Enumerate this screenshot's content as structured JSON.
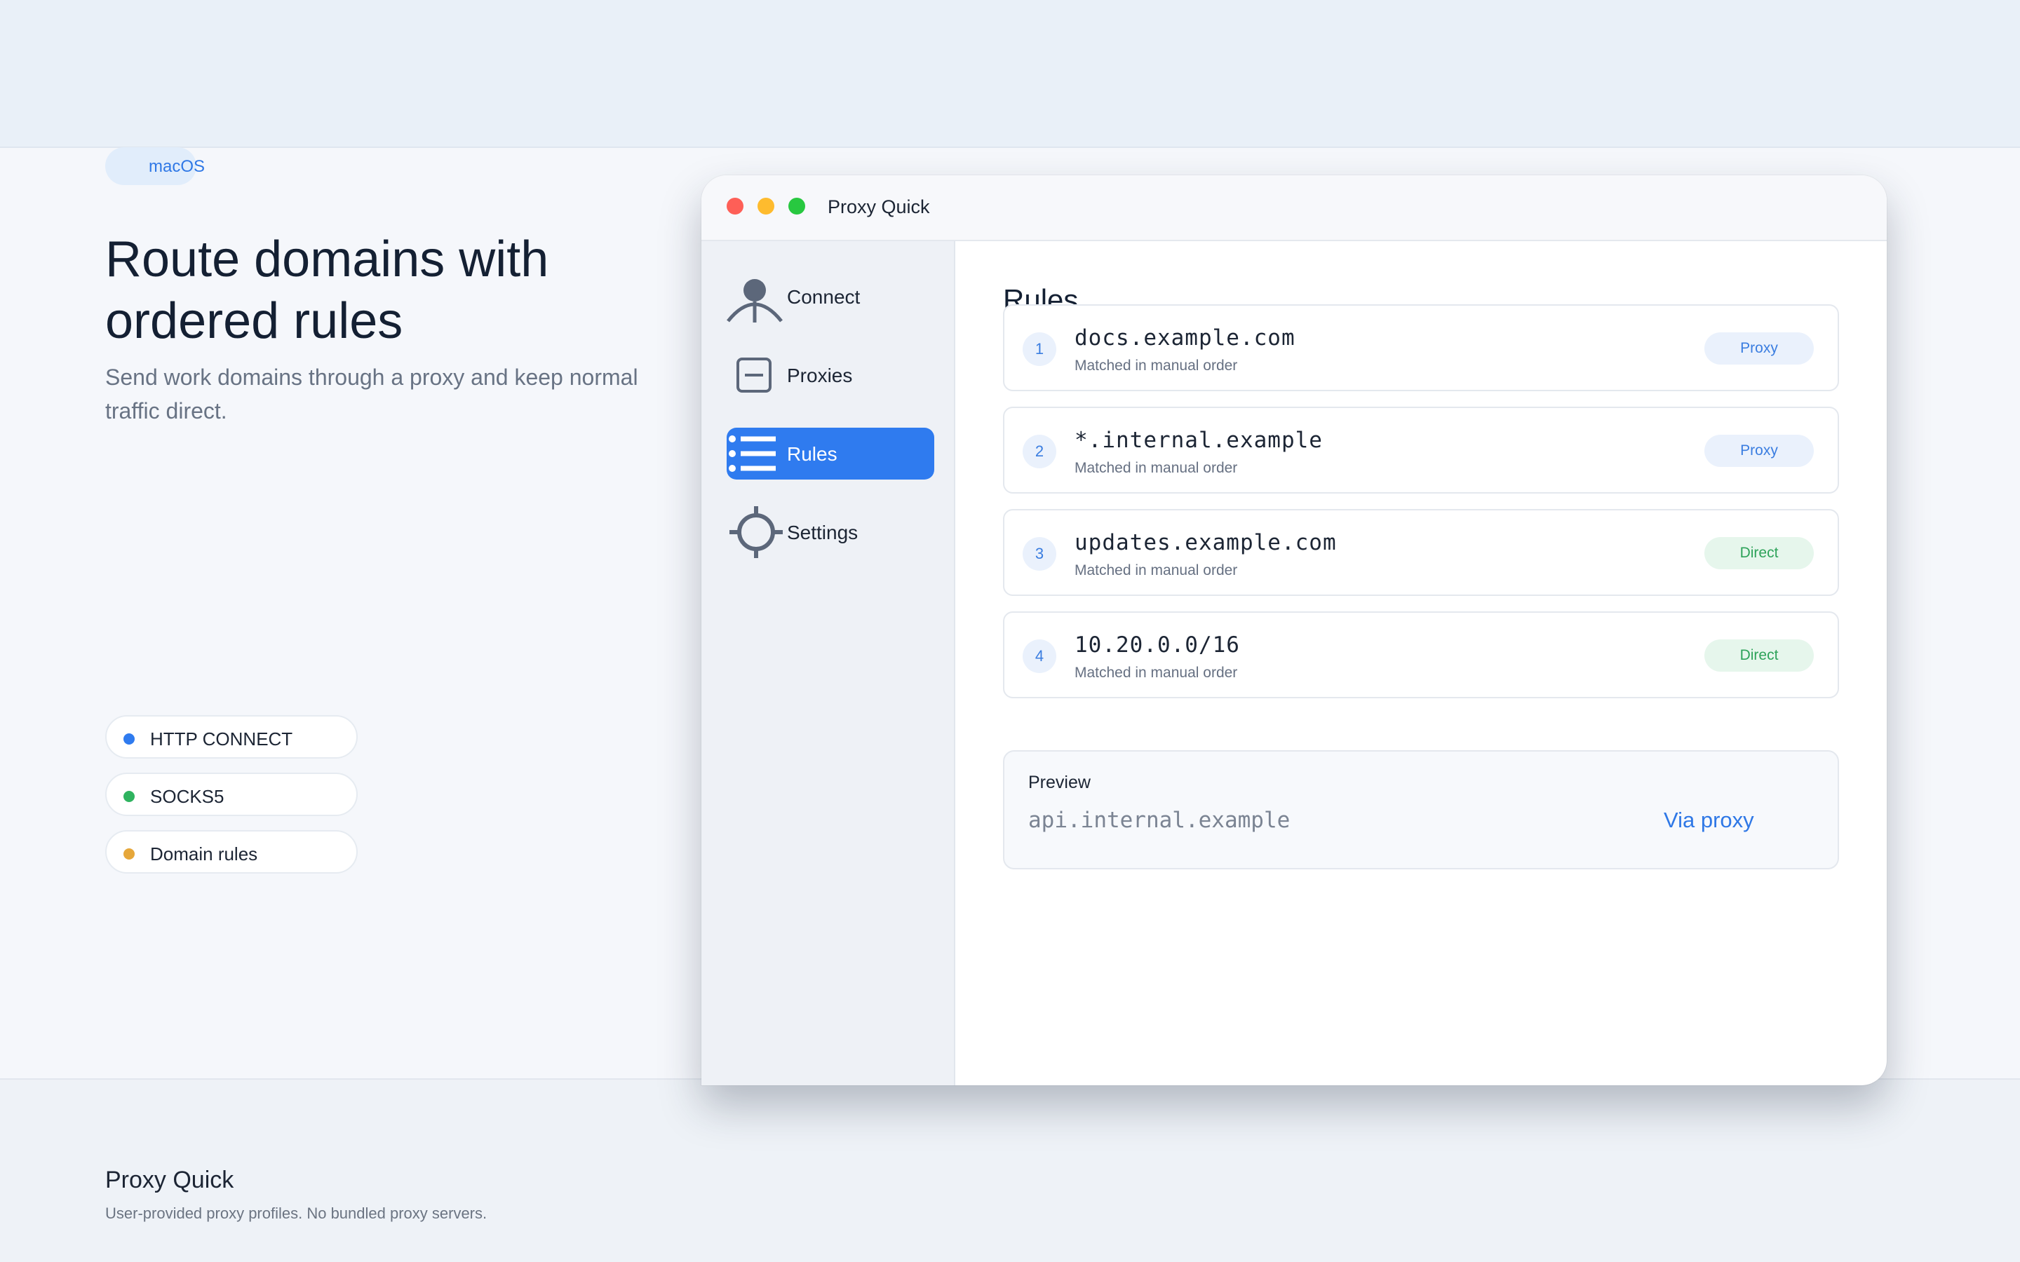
{
  "page": {
    "badge": "macOS",
    "headline": "Route domains with ordered rules",
    "subheadline": "Send work domains through a proxy and keep normal traffic direct.",
    "features": [
      {
        "label": "HTTP CONNECT",
        "color": "#2f7bef"
      },
      {
        "label": "SOCKS5",
        "color": "#2fb35f"
      },
      {
        "label": "Domain rules",
        "color": "#e6a73a"
      }
    ]
  },
  "window": {
    "title": "Proxy Quick",
    "traffic_colors": [
      "#fe5f57",
      "#febb2e",
      "#28c840"
    ]
  },
  "sidebar": {
    "items": [
      {
        "label": "Connect",
        "icon": "person-icon",
        "active": false
      },
      {
        "label": "Proxies",
        "icon": "server-icon",
        "active": false
      },
      {
        "label": "Rules",
        "icon": "list-icon",
        "active": true
      },
      {
        "label": "Settings",
        "icon": "crosshair-icon",
        "active": false
      }
    ]
  },
  "main": {
    "title": "Rules",
    "rules": [
      {
        "index": "1",
        "domain": "docs.example.com",
        "note": "Matched in manual order",
        "action": "Proxy"
      },
      {
        "index": "2",
        "domain": "*.internal.example",
        "note": "Matched in manual order",
        "action": "Proxy"
      },
      {
        "index": "3",
        "domain": "updates.example.com",
        "note": "Matched in manual order",
        "action": "Direct"
      },
      {
        "index": "4",
        "domain": "10.20.0.0/16",
        "note": "Matched in manual order",
        "action": "Direct"
      }
    ],
    "preview": {
      "label": "Preview",
      "domain": "api.internal.example",
      "result": "Via proxy"
    }
  },
  "footer": {
    "title": "Proxy Quick",
    "subtitle": "User-provided proxy profiles. No bundled proxy servers."
  },
  "colors": {
    "accent": "#2f7bef",
    "proxy_badge": "#3a7de0",
    "direct_badge": "#2ea35a"
  }
}
